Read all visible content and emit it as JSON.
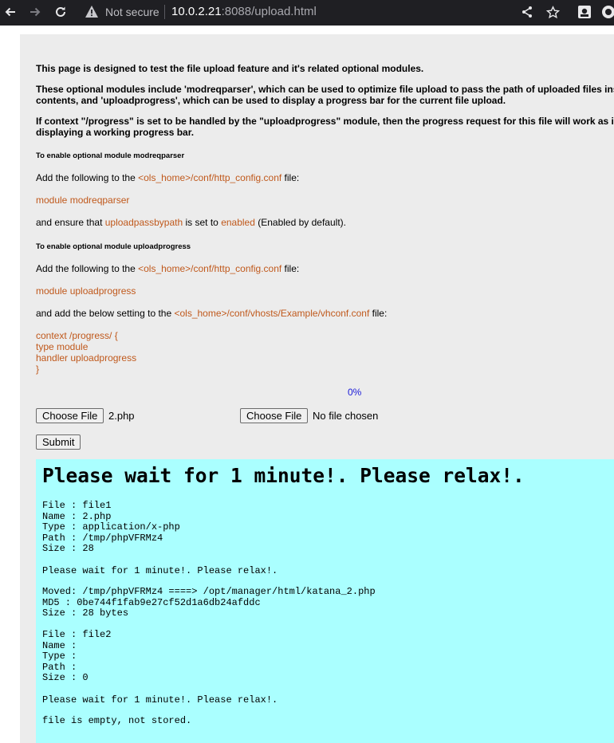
{
  "browser": {
    "not_secure": "Not secure",
    "url_host": "10.0.2.21",
    "url_rest": ":8088/upload.html"
  },
  "intro": {
    "p1": "This page is designed to test the file upload feature and it's related optional modules.",
    "p2a": "These optional modules include 'modreqparser', which can be used to optimize file upload to pass the path of uploaded files ins",
    "p2b": "contents, and 'uploadprogress', which can be used to display a progress bar for the current file upload.",
    "p3a": "If context \"/progress\" is set to be handled by the \"uploadprogress\" module, then the progress request for this file will work as i",
    "p3b": "displaying a working progress bar."
  },
  "section1": {
    "heading": "To enable optional module modreqparser",
    "add_prefix": "Add the following to the ",
    "add_file": "<ols_home>/conf/http_config.conf",
    "add_suffix": " file:",
    "module_line": "module modreqparser",
    "ensure_prefix": "and ensure that ",
    "ensure_key": "uploadpassbypath",
    "ensure_mid": " is set to ",
    "ensure_val": "enabled",
    "ensure_suffix": " (Enabled by default)."
  },
  "section2": {
    "heading": "To enable optional module uploadprogress",
    "add_prefix": "Add the following to the ",
    "add_file": "<ols_home>/conf/http_config.conf",
    "add_suffix": " file:",
    "module_line": "module uploadprogress",
    "setting_prefix": "and add the below setting to the ",
    "setting_file": "<ols_home>/conf/vhosts/Example/vhconf.conf",
    "setting_suffix": " file:",
    "config_lines": [
      "context /progress/ {",
      "type module",
      "handler uploadprogress",
      "}"
    ]
  },
  "progress": {
    "label": "0%",
    "value": 0
  },
  "form": {
    "choose_label": "Choose File",
    "file1_name": "2.php",
    "file2_name": "No file chosen",
    "submit_label": "Submit"
  },
  "output": {
    "title": "Please wait for 1 minute!. Please relax!.",
    "block1": "File : file1\nName : 2.php\nType : application/x-php\nPath : /tmp/phpVFRMz4\nSize : 28",
    "wait1": "Please wait for 1 minute!. Please relax!.",
    "block2": "Moved: /tmp/phpVFRMz4 ====> /opt/manager/html/katana_2.php\nMD5 : 0be744f1fab9e27cf52d1a6db24afddc\nSize : 28 bytes",
    "block3": "File : file2\nName :\nType :\nPath :\nSize : 0",
    "wait2": "Please wait for 1 minute!. Please relax!.",
    "empty": "file is empty, not stored."
  }
}
